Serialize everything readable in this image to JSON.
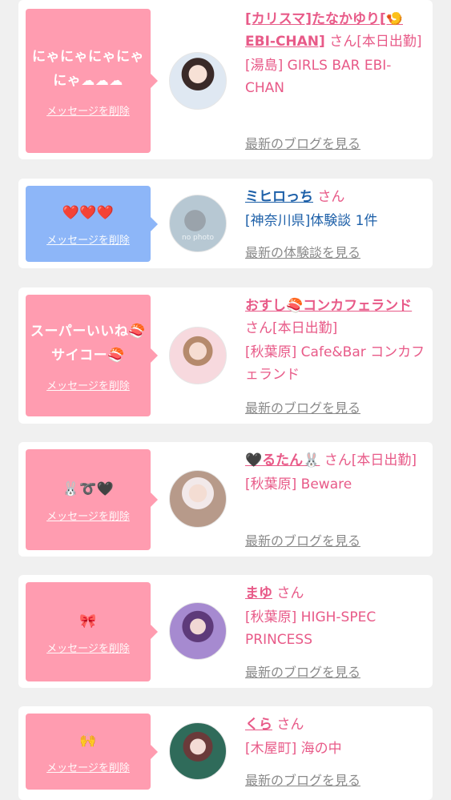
{
  "colors": {
    "pink_bubble": "#ff9cb0",
    "blue_bubble": "#8db6f8",
    "pink_text": "#e85a88",
    "blue_text": "#1c5fa8",
    "gray_link": "#8a8a8a"
  },
  "delete_label": "メッセージを削除",
  "san": "さん",
  "items": [
    {
      "message": [
        "にゃにゃにゃにゃ",
        "にゃ☁☁☁"
      ],
      "name": "[カリスマ]たなかゆり[🍤EBI-CHAN]",
      "status": "[本日出勤]",
      "shop": "[湯島] GIRLS BAR EBI-CHAN",
      "link": "最新のブログを見る"
    },
    {
      "message": [
        "❤️❤️❤️"
      ],
      "name": "ミヒロっち",
      "status": "",
      "shop": "[神奈川県]体験談 1件",
      "link": "最新の体験談を見る",
      "avatar_text": "no photo"
    },
    {
      "message": [
        "スーパーいいね🍣",
        "サイコー🍣"
      ],
      "name": "おすし🍣コンカフェランド",
      "status": "[本日出勤]",
      "shop": "[秋葉原] Cafe&Bar コンカフェランド",
      "link": "最新のブログを見る"
    },
    {
      "message": [
        "🐰➰🖤"
      ],
      "name": "🖤るたん🐰",
      "status": "[本日出勤]",
      "shop": "[秋葉原] Beware",
      "link": "最新のブログを見る"
    },
    {
      "message": [
        "🎀"
      ],
      "name": "まゆ",
      "status": "",
      "shop": "[秋葉原] HIGH-SPEC PRINCESS",
      "link": "最新のブログを見る"
    },
    {
      "message": [
        "🙌"
      ],
      "name": "くら",
      "status": "",
      "shop": "[木屋町] 海の中",
      "link": "最新のブログを見る"
    }
  ]
}
